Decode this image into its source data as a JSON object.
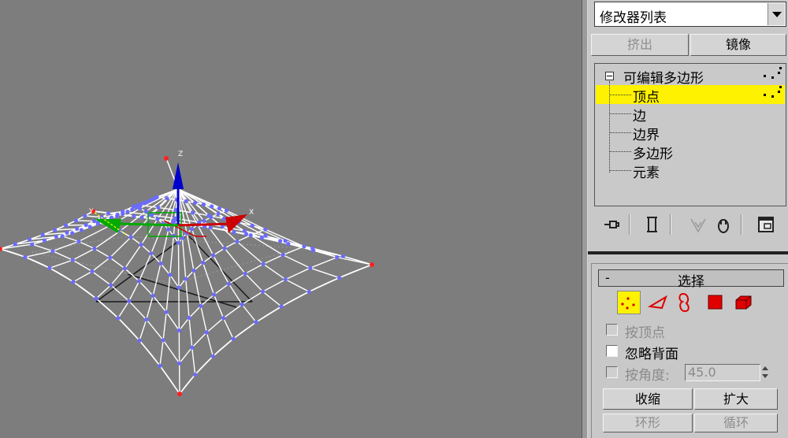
{
  "modifier_list": {
    "value": "修改器列表"
  },
  "buttons": {
    "extrude": "挤出",
    "mirror": "镜像",
    "shrink": "收缩",
    "grow": "扩大",
    "ring": "环形",
    "loop": "循环"
  },
  "stack": {
    "root": "可编辑多边形",
    "items": [
      "顶点",
      "边",
      "边界",
      "多边形",
      "元素"
    ],
    "selected_index": 0
  },
  "toolbar_icons": [
    "pin-stack-icon",
    "show-end-result-icon",
    "make-unique-icon",
    "remove-modifier-icon",
    "configure-modifier-sets-icon"
  ],
  "selection": {
    "title": "选择",
    "collapse_symbol": "-",
    "subobject_icons": [
      "vertex-icon",
      "edge-icon",
      "border-icon",
      "polygon-icon",
      "element-icon"
    ],
    "by_vertex": "按顶点",
    "ignore_backfacing": "忽略背面",
    "by_angle": "按角度:",
    "angle_value": "45.0"
  },
  "viewport": {
    "axis_z": "Z",
    "axis_x": "X",
    "axis_y": "Y"
  },
  "colors": {
    "highlight": "#fff200",
    "vertex": "#6b6bff",
    "wire": "#ffffff",
    "gizmo_z": "#0000cc",
    "gizmo_x": "#cc0000",
    "gizmo_y": "#00aa00"
  }
}
